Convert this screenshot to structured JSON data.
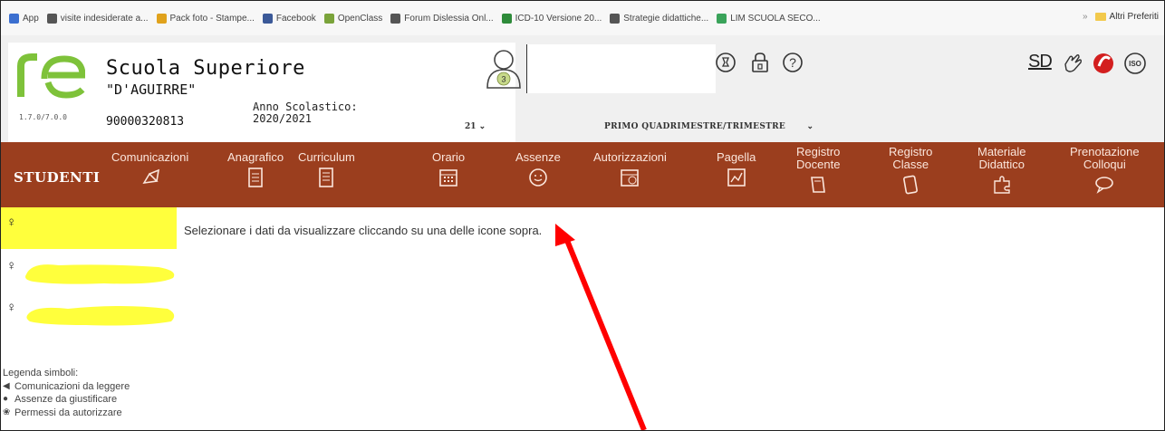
{
  "bookmarks": [
    {
      "label": "App",
      "color": "#3b6fd0"
    },
    {
      "label": "visite indesiderate a...",
      "color": "#555555"
    },
    {
      "label": "Pack foto - Stampe...",
      "color": "#e0a21c"
    },
    {
      "label": "Facebook",
      "color": "#3b5998"
    },
    {
      "label": "OpenClass",
      "color": "#7aa33a"
    },
    {
      "label": "Forum Dislessia Onl...",
      "color": "#555555"
    },
    {
      "label": "ICD-10 Versione 20...",
      "color": "#2e8b3a"
    },
    {
      "label": "Strategie didattiche...",
      "color": "#555555"
    },
    {
      "label": "LIM SCUOLA SECO...",
      "color": "#3aa35a"
    }
  ],
  "bookmarks_more": "»",
  "bookmarks_other": "Altri Preferiti",
  "header": {
    "version": "1.7.0/7.0.0",
    "school_name": "Scuola Superiore",
    "school_sub": "\"D'AGUIRRE\"",
    "school_code": "90000320813",
    "year_label": "Anno Scolastico:",
    "year_value": "2020/2021",
    "user_badge": "3",
    "year_select": "21",
    "period_select": "PRIMO QUADRIMESTRE/TRIMESTRE",
    "right_badge": "SD"
  },
  "nav": {
    "section": "STUDENTI",
    "items": [
      {
        "label": "Comunicazioni",
        "icon": "megaphone-icon"
      },
      {
        "label": "Anagrafico",
        "icon": "id-card-icon"
      },
      {
        "label": "Curriculum",
        "icon": "document-icon"
      },
      {
        "label": "Orario",
        "icon": "calendar-icon"
      },
      {
        "label": "Assenze",
        "icon": "smiley-icon"
      },
      {
        "label": "Autorizzazioni",
        "icon": "calendar-check-icon"
      },
      {
        "label": "Pagella",
        "icon": "report-icon"
      },
      {
        "label": "Registro|Docente",
        "icon": "book-icon"
      },
      {
        "label": "Registro|Classe",
        "icon": "phone-book-icon"
      },
      {
        "label": "Materiale|Didattico",
        "icon": "puzzle-icon"
      },
      {
        "label": "Prenotazione|Colloqui",
        "icon": "chat-icon"
      }
    ]
  },
  "students": [
    {
      "sex": "♀"
    },
    {
      "sex": "♀"
    },
    {
      "sex": "♀"
    }
  ],
  "message": "Selezionare i dati da visualizzare cliccando su una delle icone sopra.",
  "legend": {
    "title": "Legenda simboli:",
    "items": [
      {
        "text": "Comunicazioni da leggere",
        "icon": "megaphone-icon"
      },
      {
        "text": "Assenze da giustificare",
        "icon": "alert-icon"
      },
      {
        "text": "Permessi da autorizzare",
        "icon": "paw-icon"
      }
    ]
  },
  "colors": {
    "nav_bg": "#9b3e1e",
    "highlight": "#ffff3c",
    "arrow": "#ff0000",
    "logo": "#7ec23a"
  }
}
